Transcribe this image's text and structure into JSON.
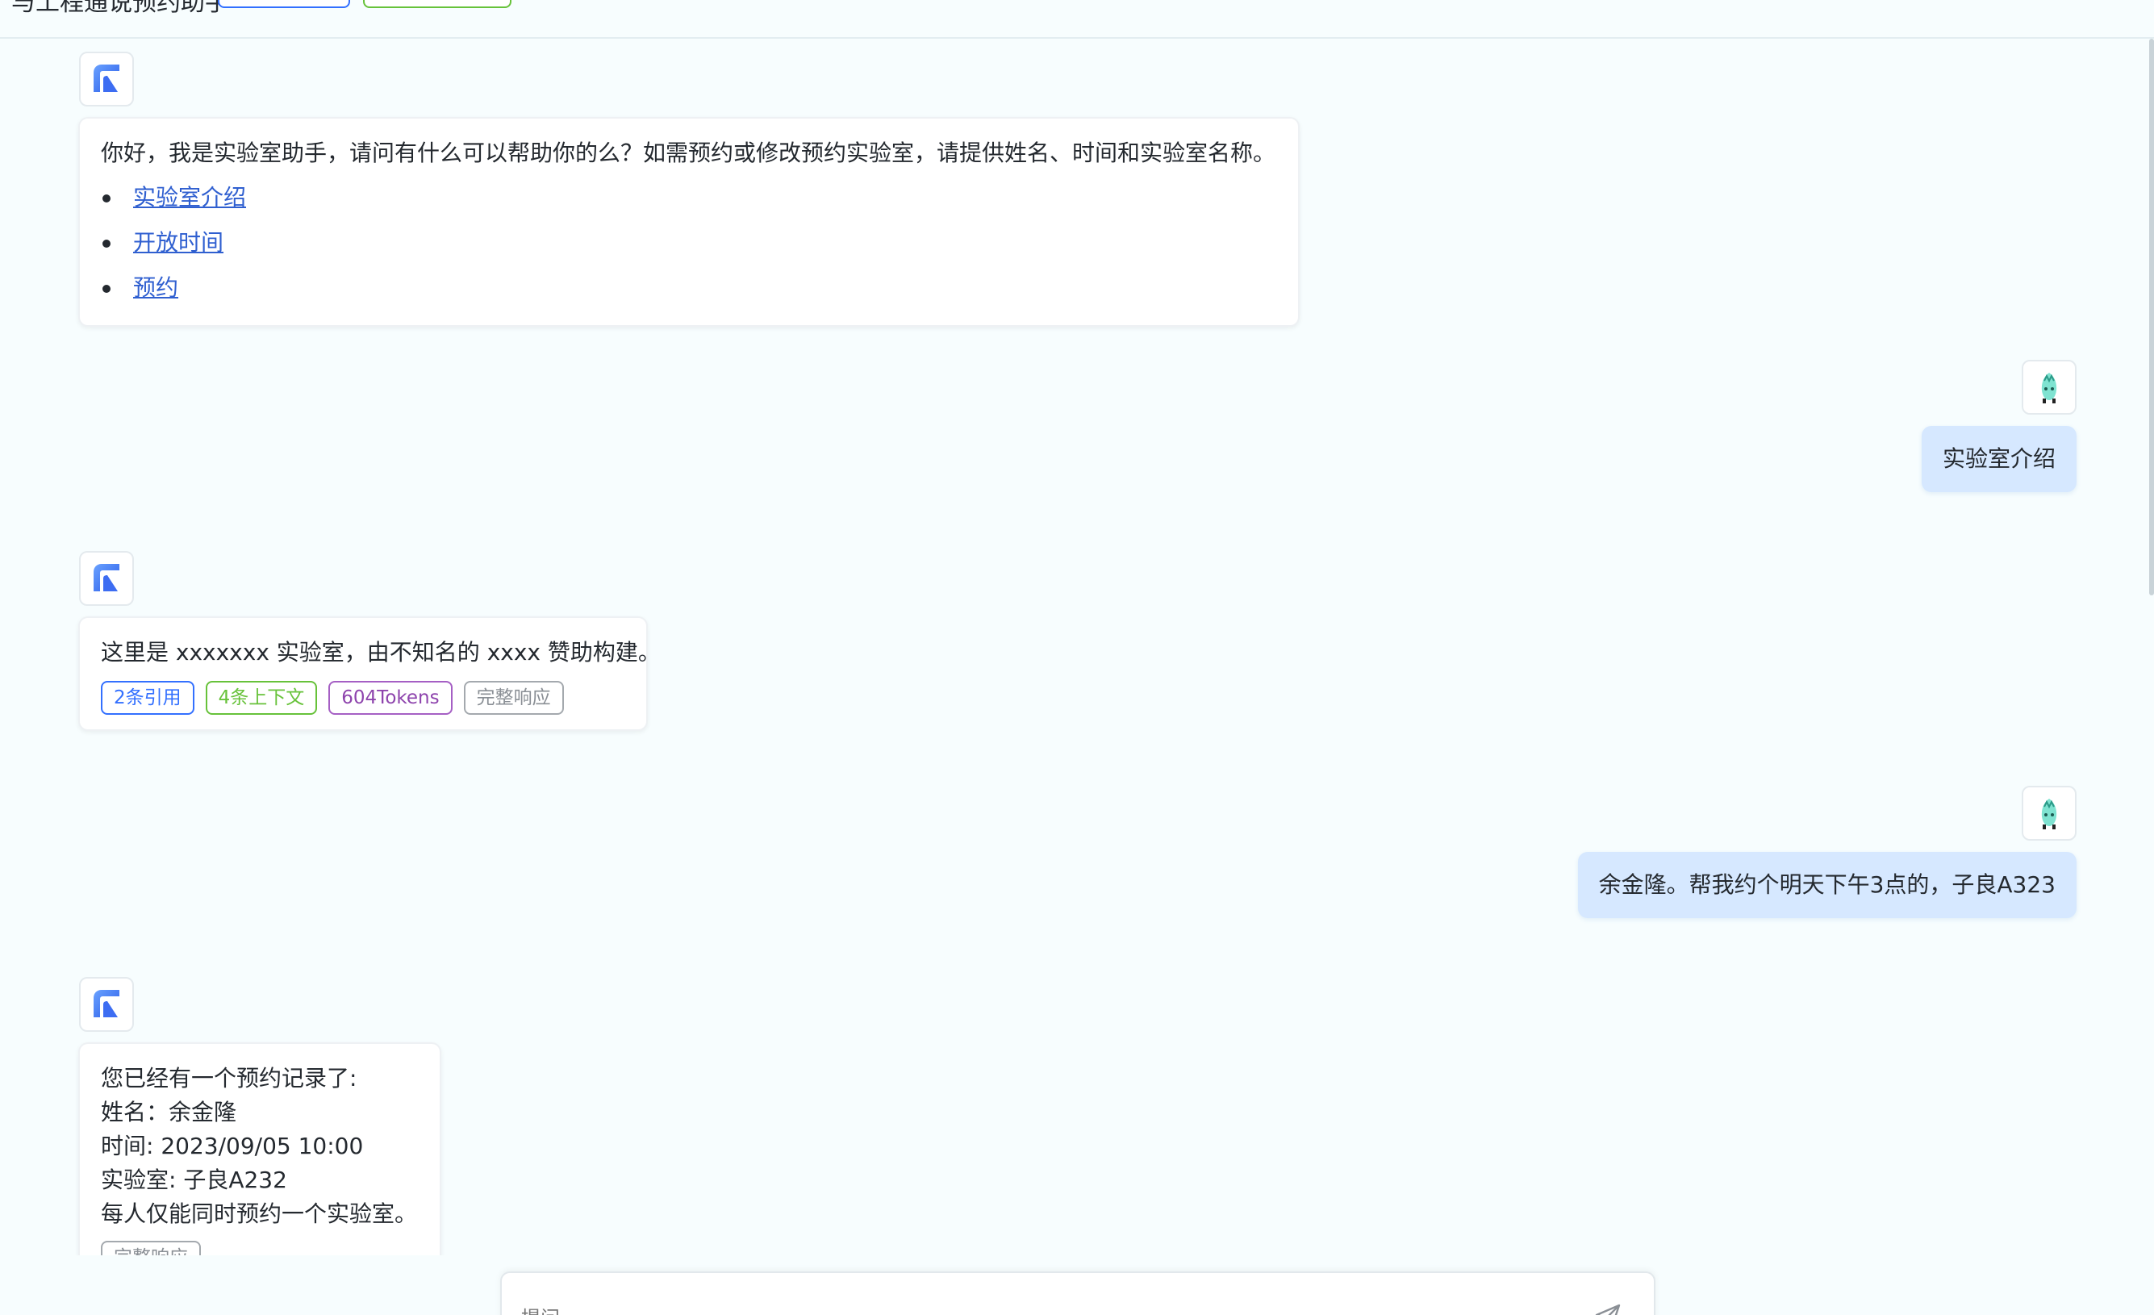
{
  "colors": {
    "accent": "#3370ff",
    "page_bg": "#f7fdfe",
    "user_bubble": "#d6e8ff",
    "link": "#2f5fd0",
    "tag_green": "#67c23a",
    "tag_purple": "#8e44ad",
    "tag_gray": "#8a8f95"
  },
  "header": {
    "title": "与工程通说预约助手"
  },
  "icons": {
    "assistant_avatar": "brand-logo-icon",
    "user_avatar": "user-avatar-icon",
    "send": "send-icon"
  },
  "messages": [
    {
      "role": "assistant",
      "text": "你好，我是实验室助手，请问有什么可以帮助你的么？如需预约或修改预约实验室，请提供姓名、时间和实验室名称。",
      "quick_links": [
        "实验室介绍",
        "开放时间",
        "预约"
      ]
    },
    {
      "role": "user",
      "text": "实验室介绍"
    },
    {
      "role": "assistant",
      "text": "这里是 xxxxxxx 实验室，由不知名的 xxxx 赞助构建。",
      "tags": {
        "quotes": "2条引用",
        "context": "4条上下文",
        "tokens": "604Tokens",
        "full_response": "完整响应"
      }
    },
    {
      "role": "user",
      "text": "余金隆。帮我约个明天下午3点的，子良A323"
    },
    {
      "role": "assistant",
      "lines": [
        "您已经有一个预约记录了:",
        "姓名：余金隆",
        "时间: 2023/09/05 10:00",
        "实验室: 子良A232",
        "每人仅能同时预约一个实验室。"
      ],
      "tags": {
        "full_response": "完整响应"
      }
    }
  ],
  "input": {
    "placeholder": "提问"
  }
}
